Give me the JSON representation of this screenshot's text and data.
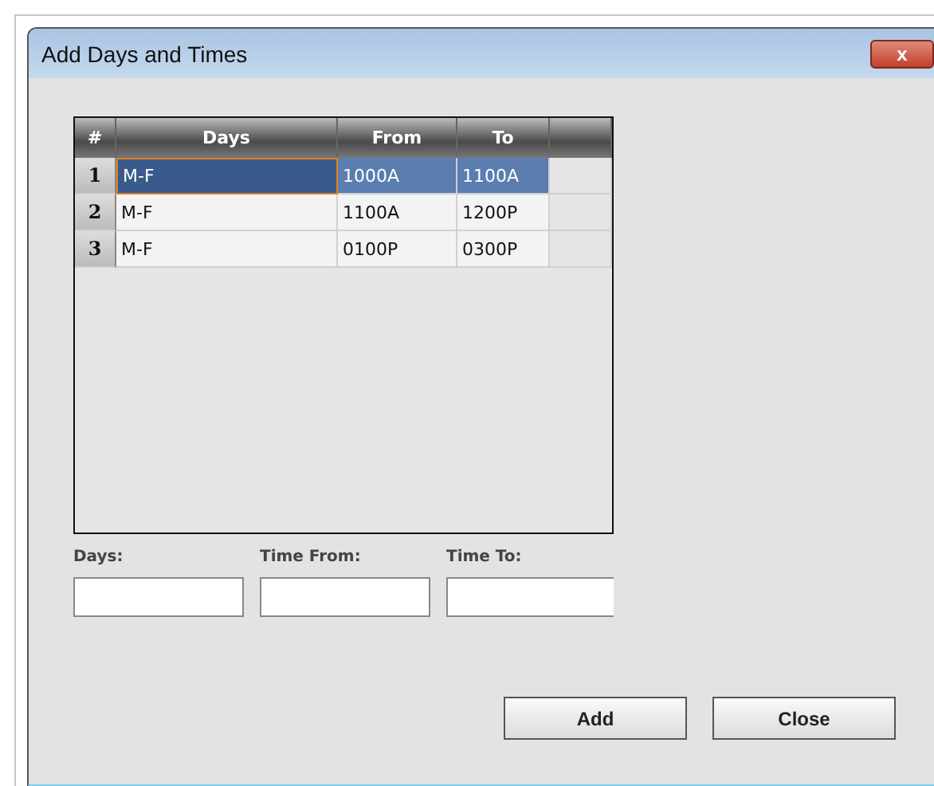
{
  "window": {
    "title": "Add Days and Times",
    "close_label": "x"
  },
  "table": {
    "columns": [
      "#",
      "Days",
      "From",
      "To"
    ],
    "rows": [
      {
        "num": "1",
        "days": "M-F",
        "from": "1000A",
        "to": "1100A",
        "selected": true
      },
      {
        "num": "2",
        "days": "M-F",
        "from": "1100A",
        "to": "1200P",
        "selected": false
      },
      {
        "num": "3",
        "days": "M-F",
        "from": "0100P",
        "to": "0300P",
        "selected": false
      }
    ]
  },
  "fields": [
    {
      "label": "Days:"
    },
    {
      "label": "Time From:"
    },
    {
      "label": "Time To:"
    }
  ],
  "buttons": [
    "Add",
    "Close"
  ]
}
